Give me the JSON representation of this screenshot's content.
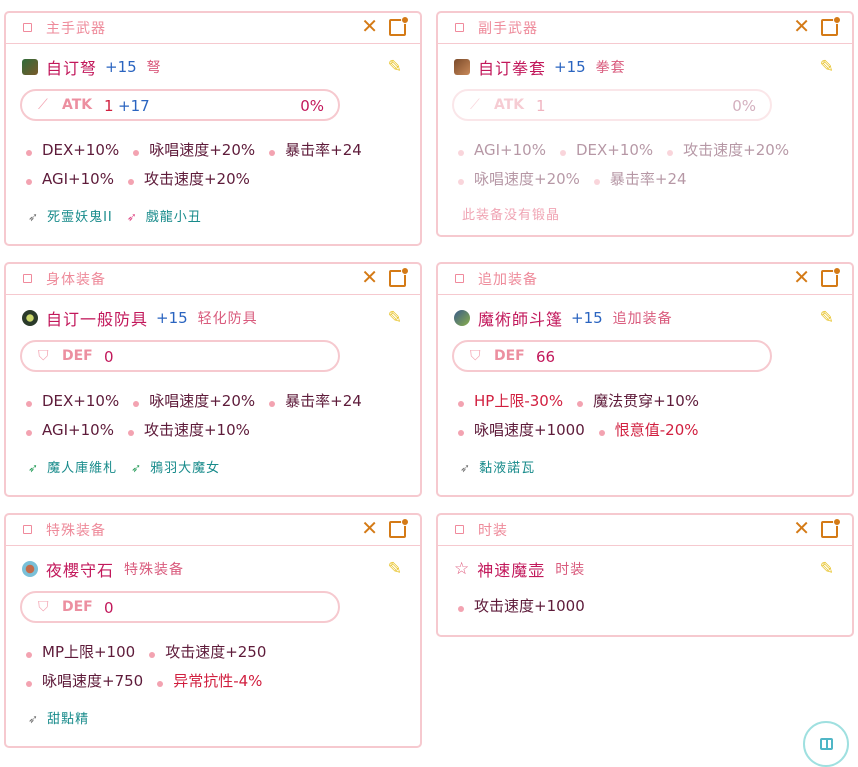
{
  "slots": [
    {
      "title": "主手武器",
      "item": {
        "name": "自订弩",
        "refine": "+15",
        "type": "弩"
      },
      "stat": {
        "label": "ATK",
        "value": "1",
        "value2": "+17",
        "pct": "0%"
      },
      "lines": [
        [
          {
            "t": "DEX+10%"
          },
          {
            "t": "咏唱速度+20%"
          },
          {
            "t": "暴击率+24"
          }
        ],
        [
          {
            "t": "AGI+10%"
          },
          {
            "t": "攻击速度+20%"
          }
        ]
      ],
      "cards": [
        {
          "name": "死霊妖鬼II",
          "icon": "gray-card-icon"
        },
        {
          "name": "戲龍小丑",
          "icon": "pink-card-icon"
        }
      ]
    },
    {
      "title": "副手武器",
      "item": {
        "name": "自订拳套",
        "refine": "+15",
        "type": "拳套"
      },
      "stat": {
        "label": "ATK",
        "value": "1",
        "pct": "0%"
      },
      "lines": [
        [
          {
            "t": "AGI+10%"
          },
          {
            "t": "DEX+10%"
          },
          {
            "t": "攻击速度+20%"
          }
        ],
        [
          {
            "t": "咏唱速度+20%"
          },
          {
            "t": "暴击率+24"
          }
        ]
      ],
      "empty_note": "此装备没有锻晶"
    },
    {
      "title": "身体装备",
      "item": {
        "name": "自订一般防具",
        "refine": "+15",
        "type": "轻化防具"
      },
      "stat": {
        "label": "DEF",
        "value": "0"
      },
      "lines": [
        [
          {
            "t": "DEX+10%"
          },
          {
            "t": "咏唱速度+20%"
          },
          {
            "t": "暴击率+24"
          }
        ],
        [
          {
            "t": "AGI+10%"
          },
          {
            "t": "攻击速度+10%"
          }
        ]
      ],
      "cards": [
        {
          "name": "魔人庫維札",
          "icon": "green-card-icon"
        },
        {
          "name": "鴉羽大魔女",
          "icon": "green-card-icon"
        }
      ]
    },
    {
      "title": "追加装备",
      "item": {
        "name": "魔術師斗篷",
        "refine": "+15",
        "type": "追加装备"
      },
      "stat": {
        "label": "DEF",
        "value": "66"
      },
      "lines": [
        [
          {
            "t": "HP上限-30%",
            "red": true
          },
          {
            "t": "魔法贯穿+10%"
          }
        ],
        [
          {
            "t": "咏唱速度+1000"
          },
          {
            "t": "恨意值-20%",
            "red": true
          }
        ]
      ],
      "cards": [
        {
          "name": "黏液諾瓦",
          "icon": "gray-card-icon"
        }
      ]
    },
    {
      "title": "特殊装备",
      "item": {
        "name": "夜櫻守石",
        "type": "特殊装备"
      },
      "stat": {
        "label": "DEF",
        "value": "0"
      },
      "lines": [
        [
          {
            "t": "MP上限+100"
          },
          {
            "t": "攻击速度+250"
          }
        ],
        [
          {
            "t": "咏唱速度+750"
          },
          {
            "t": "异常抗性-4%",
            "red": true
          }
        ]
      ],
      "cards": [
        {
          "name": "甜點精",
          "icon": "gray-card-icon"
        }
      ]
    },
    {
      "title": "时装",
      "item": {
        "name": "神速魔壶",
        "type": "时装"
      },
      "lines": [
        [
          {
            "t": "攻击速度+1000"
          }
        ]
      ]
    }
  ],
  "icons": {
    "close": "✕",
    "edit": "✎",
    "star": "☆",
    "sword": "🗡",
    "shield": "⛉"
  },
  "colors": {
    "border": "#f6c9cf",
    "accent_orange": "#d47a16",
    "name": "#c2185b",
    "refine": "#2a64c0",
    "red_stat": "#d11f3f",
    "card_text": "#188b8b"
  }
}
